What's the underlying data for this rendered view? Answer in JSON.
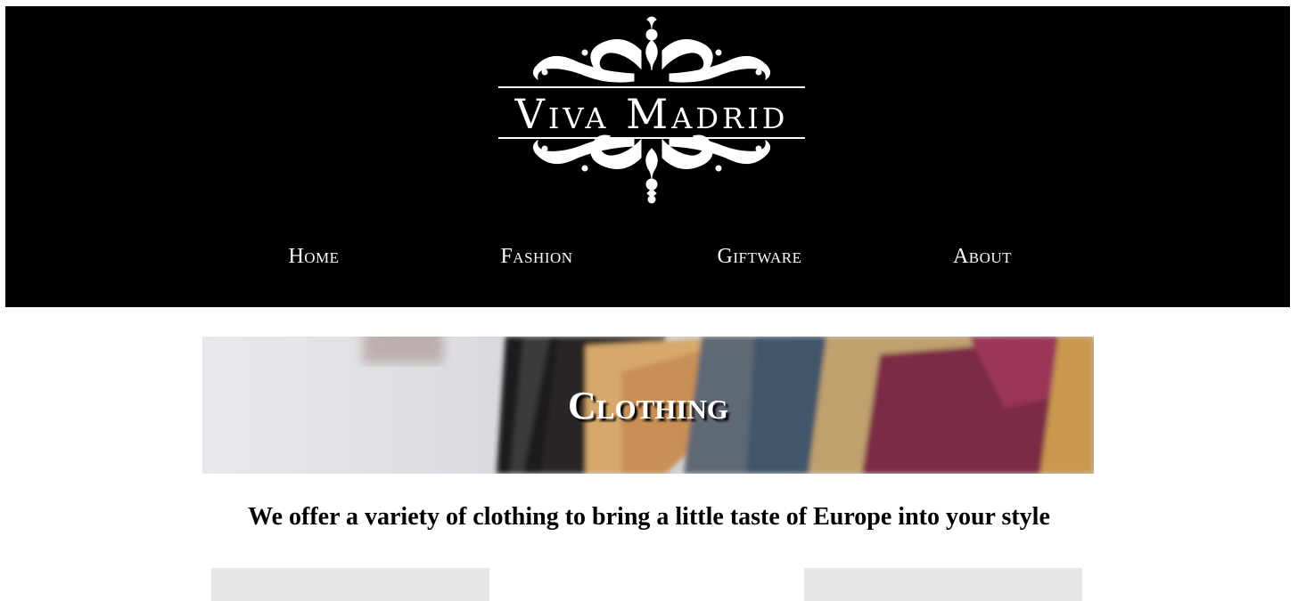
{
  "header": {
    "logo_text": "Viva Madrid",
    "background": "#000000"
  },
  "nav": {
    "items": [
      {
        "label": "Home"
      },
      {
        "label": "Fashion"
      },
      {
        "label": "Giftware"
      },
      {
        "label": "About"
      }
    ]
  },
  "banner": {
    "title": "Clothing"
  },
  "main": {
    "tagline": "We offer a variety of clothing to bring a little taste of Europe into your style"
  },
  "colors": {
    "header_bg": "#000000",
    "text_light": "#ffffff",
    "card_bg": "#e6e6e6"
  }
}
